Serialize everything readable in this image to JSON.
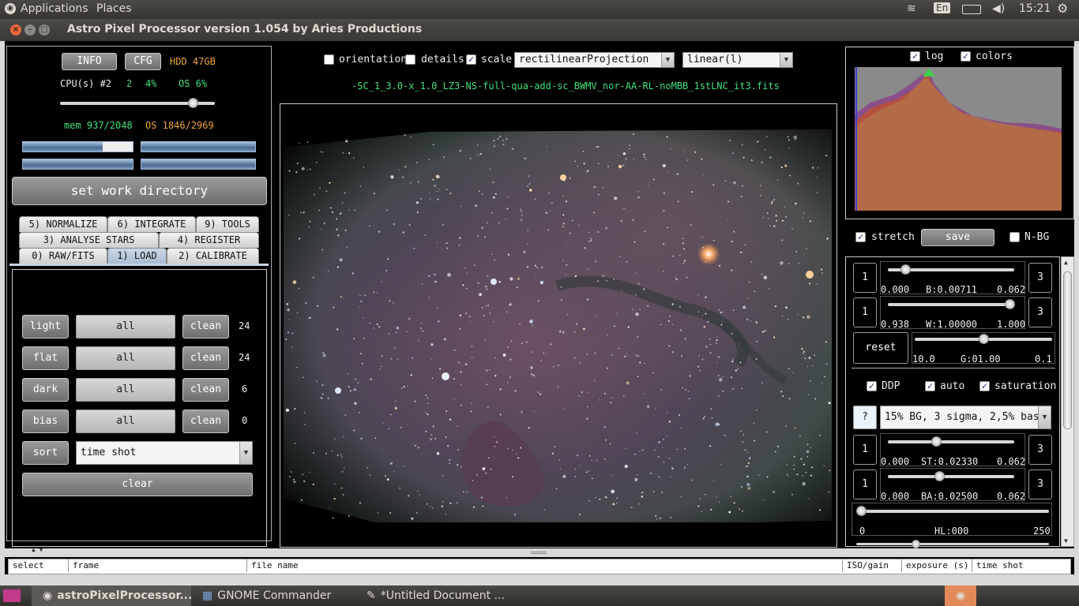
{
  "topbar": {
    "applications": "Applications",
    "places": "Places",
    "lang": "En",
    "clock": "15:21"
  },
  "window": {
    "title": "Astro Pixel Processor version 1.054 by Aries Productions"
  },
  "system": {
    "info_label": "INFO",
    "cfg_label": "CFG",
    "hdd": "HDD 47GB",
    "cpu_label": "CPU(s) #2",
    "cpu_threads": "2",
    "cpu_pct": "4%",
    "os_pct": "OS 6%",
    "cpu_slider_value": 0.88,
    "mem": "mem 937/2048",
    "os_mem": "OS 1846/2969"
  },
  "set_work_dir": "set work directory",
  "tabs": {
    "row1": [
      "5) NORMALIZE",
      "6) INTEGRATE",
      "9) TOOLS"
    ],
    "row2": [
      "3) ANALYSE STARS",
      "4) REGISTER"
    ],
    "row3": [
      "0) RAW/FITS",
      "1) LOAD",
      "2) CALIBRATE"
    ],
    "selected": "1) LOAD"
  },
  "load": {
    "rows": [
      {
        "type": "light",
        "all": "all",
        "clean": "clean",
        "count": "24"
      },
      {
        "type": "flat",
        "all": "all",
        "clean": "clean",
        "count": "24"
      },
      {
        "type": "dark",
        "all": "all",
        "clean": "clean",
        "count": "6"
      },
      {
        "type": "bias",
        "all": "all",
        "clean": "clean",
        "count": "0"
      }
    ],
    "sort_label": "sort",
    "sort_value": "time shot",
    "clear_label": "clear"
  },
  "viewer": {
    "orientation": "orientation",
    "details": "details",
    "scale": "scale",
    "projection": "rectilinearProjection",
    "stretch_mode": "linear(l)",
    "filename": "-SC_1_3.0-x_1.0_LZ3-NS-full-qua-add-sc_BWMV_nor-AA-RL-noMBB_1stLNC_it3.fits"
  },
  "histogram": {
    "log": "log",
    "colors": "colors"
  },
  "right": {
    "stretch": "stretch",
    "save": "save",
    "nbg": "N-BG",
    "b": {
      "left": "1",
      "right": "3",
      "min": "0.000",
      "label": "B:0.00711",
      "max": "0.062",
      "value": 0.11
    },
    "w": {
      "left": "1",
      "right": "3",
      "min": "0.938",
      "label": "W:1.00000",
      "max": "1.000",
      "value": 1.0
    },
    "reset": "reset",
    "g": {
      "min": "10.0",
      "label": "G:01.00",
      "max": "0.1",
      "value": 0.5
    },
    "ddp": "DDP",
    "auto": "auto",
    "saturation": "saturation",
    "help": "?",
    "preset": "15% BG, 3 sigma, 2,5% base",
    "st": {
      "left": "1",
      "right": "3",
      "min": "0.000",
      "label": "ST:0.02330",
      "max": "0.062",
      "value": 0.37
    },
    "ba": {
      "left": "1",
      "right": "3",
      "min": "0.000",
      "label": "BA:0.02500",
      "max": "0.062",
      "value": 0.4
    },
    "hl": {
      "min": "0",
      "label": "HL:000",
      "max": "250",
      "value": 0.0
    }
  },
  "table": {
    "columns": [
      "select",
      "frame",
      "file name",
      "ISO/gain",
      "exposure (s)",
      "time shot"
    ]
  },
  "taskbar": {
    "items": [
      "astroPixelProcessor...",
      "GNOME Commander",
      "*Untitled Document ..."
    ]
  }
}
